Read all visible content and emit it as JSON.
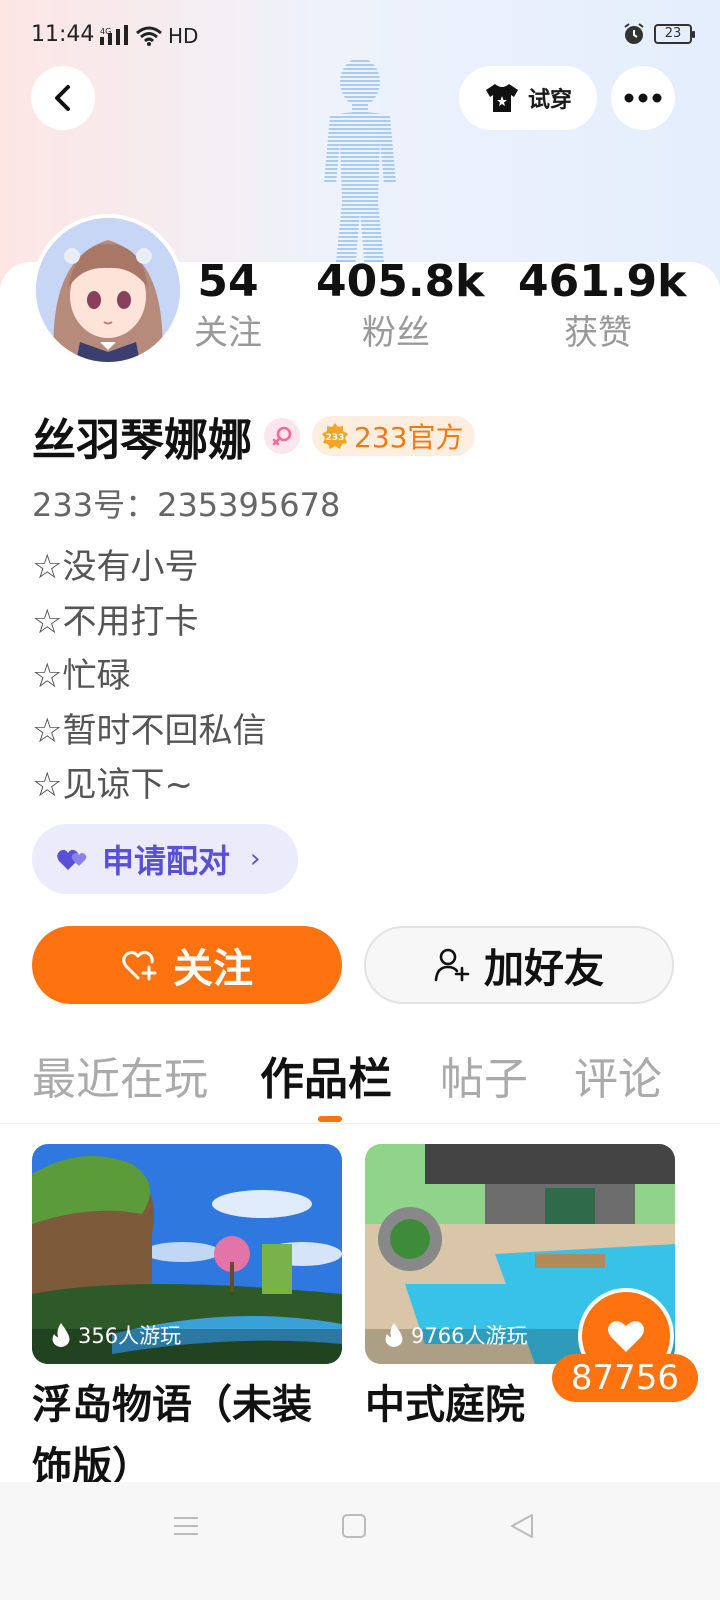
{
  "status_bar": {
    "time": "11:44",
    "network": "4G",
    "hd": "HD",
    "battery": "23"
  },
  "header": {
    "try_on_label": "试穿"
  },
  "profile": {
    "stats": [
      {
        "value": "54",
        "label": "关注"
      },
      {
        "value": "405.8k",
        "label": "粉丝"
      },
      {
        "value": "461.9k",
        "label": "获赞"
      }
    ],
    "name": "丝羽琴娜娜",
    "official_badge": "233官方",
    "uid_line": "233号：235395678",
    "bio": [
      "☆没有小号",
      "☆不用打卡",
      "☆忙碌",
      "☆暂时不回私信",
      "☆见谅下~"
    ],
    "pair_button": "申请配对"
  },
  "actions": {
    "follow": "关注",
    "add_friend": "加好友"
  },
  "tabs": [
    "最近在玩",
    "作品栏",
    "帖子",
    "评论"
  ],
  "works": [
    {
      "title": "浮岛物语（未装饰版）",
      "plays": "356人游玩"
    },
    {
      "title": "中式庭院",
      "plays": "9766人游玩"
    }
  ],
  "like_count": "87756",
  "colors": {
    "accent": "#ff7210",
    "pair_purple": "#5a50d6",
    "official_orange": "#f07a12"
  }
}
